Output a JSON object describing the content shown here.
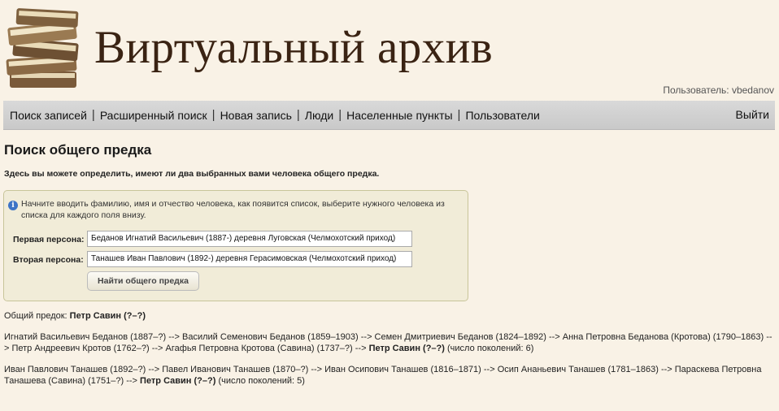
{
  "header": {
    "site_title": "Виртуальный архив",
    "user_label": "Пользователь:",
    "username": "vbedanov"
  },
  "nav": {
    "items": [
      {
        "label": "Поиск записей"
      },
      {
        "label": "Расширенный поиск"
      },
      {
        "label": "Новая запись"
      },
      {
        "label": "Люди"
      },
      {
        "label": "Населенные пункты"
      },
      {
        "label": "Пользователи"
      }
    ],
    "separator": "|",
    "logout": "Выйти"
  },
  "page": {
    "heading": "Поиск общего предка",
    "intro": "Здесь вы можете определить, имеют ли два выбранных вами человека общего предка."
  },
  "form": {
    "info_icon": "info-icon",
    "info_text": "Начните вводить фамилию, имя и отчество человека, как появится список, выберите нужного человека из списка для каждого поля внизу.",
    "first_label": "Первая персона:",
    "first_value": "Беданов Игнатий Васильевич (1887-) деревня Луговская (Челмохотский приход)",
    "second_label": "Вторая персона:",
    "second_value": "Танашев Иван Павлович (1892-) деревня Герасимовская (Челмохотский приход)",
    "button": "Найти общего предка"
  },
  "result": {
    "label": "Общий предок:",
    "ancestor": "Петр Савин (?–?)",
    "path1_text": "Игнатий Васильевич Беданов (1887–?) --> Василий Семенович Беданов (1859–1903) --> Семен Дмитриевич Беданов (1824–1892) --> Анна Петровна Беданова (Кротова) (1790–1863) --> Петр Андреевич Кротов (1762–?) --> Агафья Петровна Кротова (Савина) (1737–?) -->",
    "path1_end": "Петр Савин (?–?)",
    "path1_count": "(число поколений: 6)",
    "path2_text": "Иван Павлович Танашев (1892–?) --> Павел Иванович Танашев (1870–?) --> Иван Осипович Танашев (1816–1871) --> Осип Ананьевич Танашев (1781–1863) --> Параскева Петровна Танашева (Савина) (1751–?) -->",
    "path2_end": "Петр Савин (?–?)",
    "path2_count": "(число поколений: 5)"
  }
}
